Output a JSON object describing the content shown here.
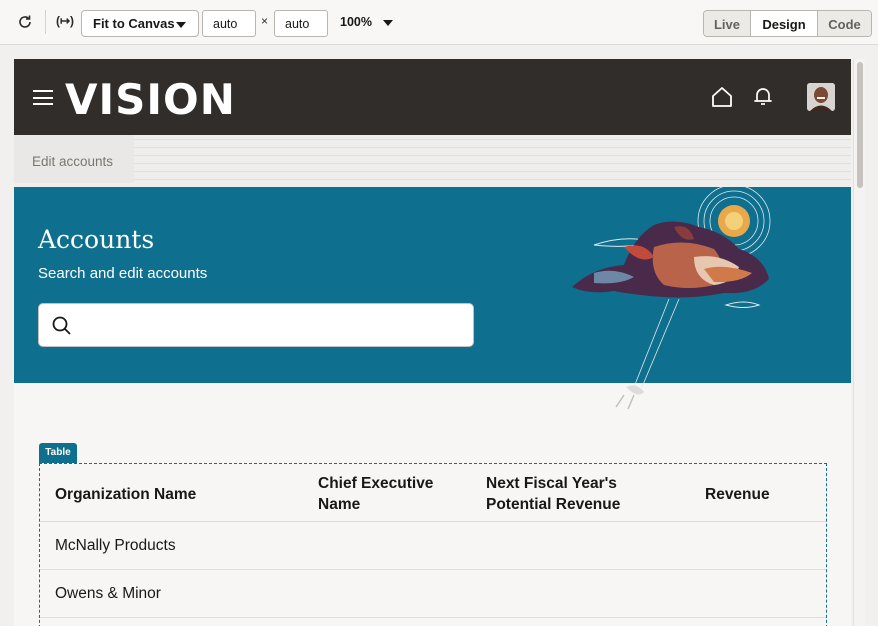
{
  "toolbar": {
    "fit_label": "Fit to Canvas",
    "width_value": "auto",
    "height_value": "auto",
    "times": "×",
    "zoom": "100%",
    "modes": [
      "Live",
      "Design",
      "Code"
    ],
    "active_mode": "Design"
  },
  "app": {
    "brand": "VISION",
    "breadcrumb": "Edit accounts",
    "hero_title": "Accounts",
    "hero_subtitle": "Search and edit accounts",
    "search_placeholder": "",
    "accent_color": "#0f6f8e",
    "header_color": "#312d2a"
  },
  "table": {
    "tag": "Table",
    "columns": [
      "Organization Name",
      "Chief Executive Name",
      "Next Fiscal Year's Potential Revenue",
      "Revenue"
    ],
    "rows": [
      [
        "McNally Products",
        "",
        "",
        ""
      ],
      [
        "Owens & Minor",
        "",
        "",
        ""
      ]
    ]
  }
}
